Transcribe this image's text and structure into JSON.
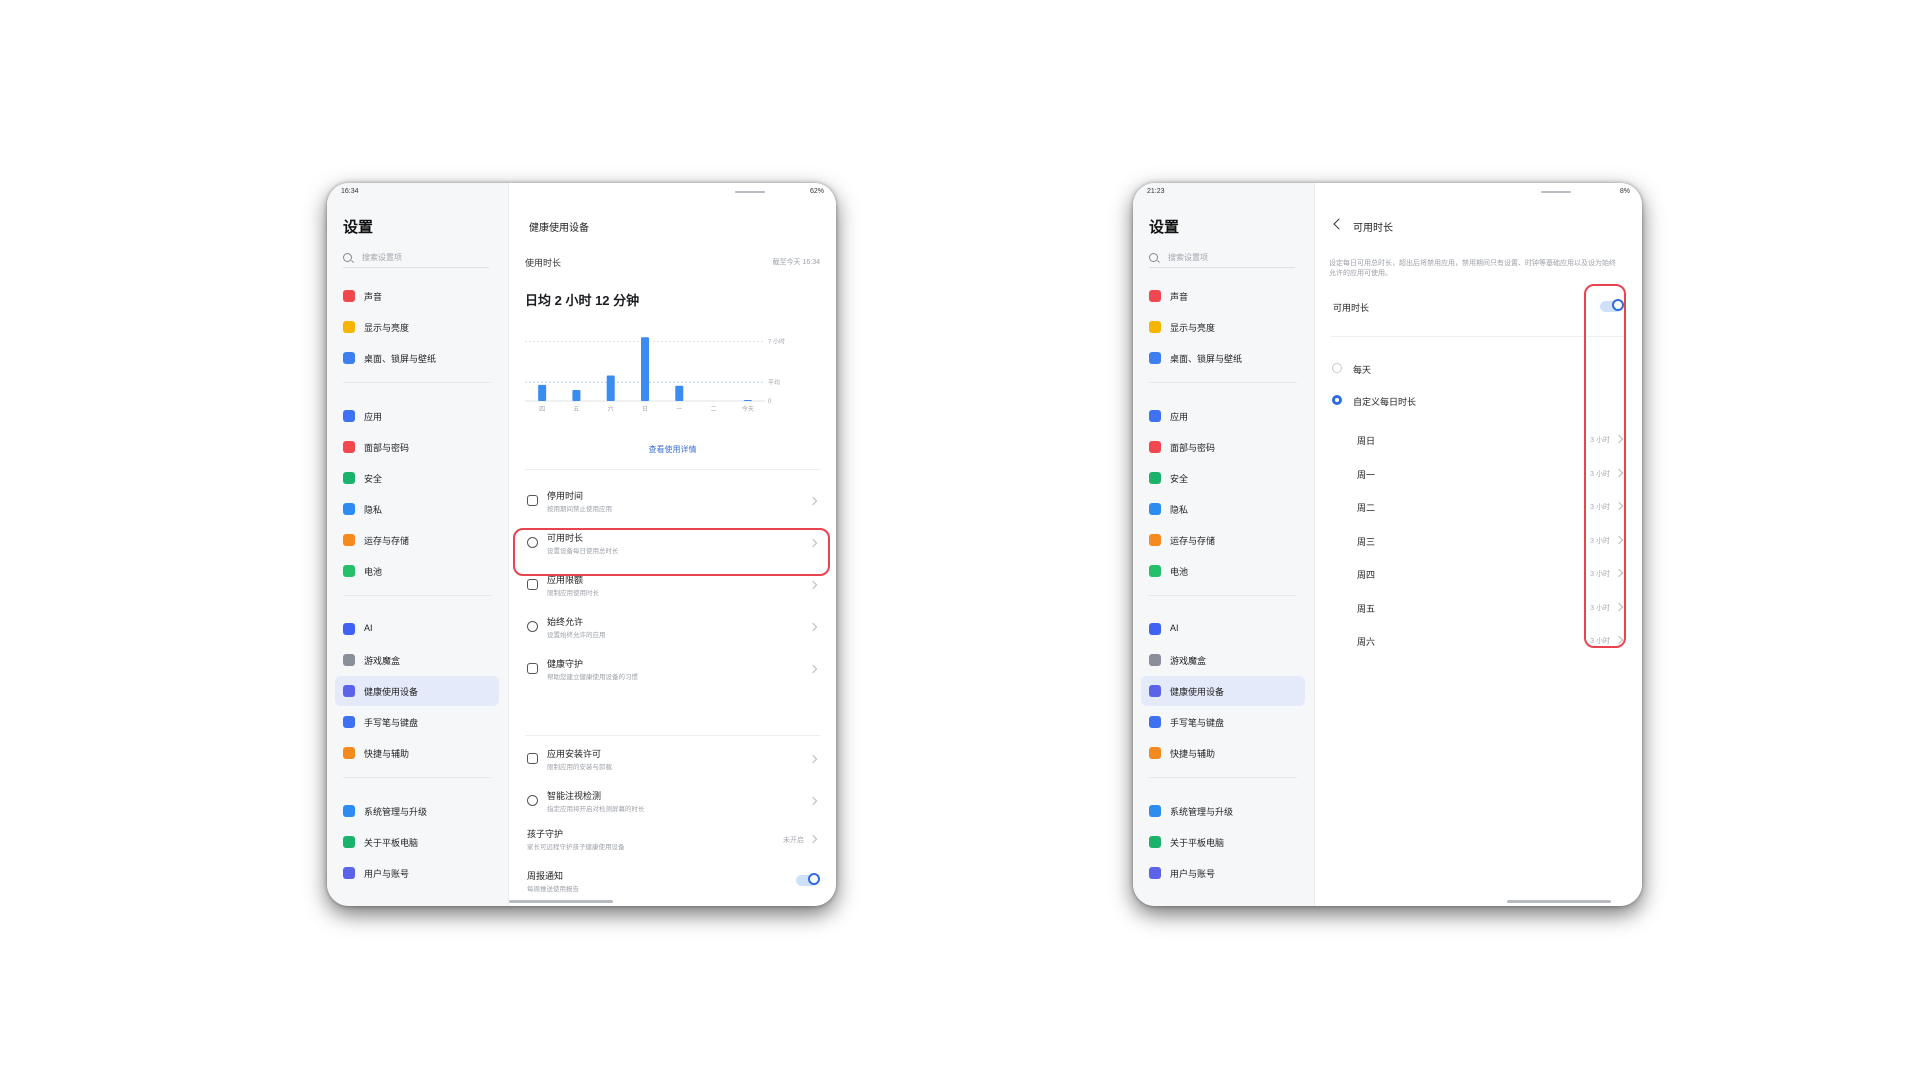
{
  "left": {
    "status_time": "16:34",
    "status_right": "62%",
    "sidebar": {
      "title": "设置",
      "search_placeholder": "搜索设置项",
      "groups": [
        [
          {
            "label": "声音",
            "icon": "speaker-icon",
            "color": "#f0484e"
          },
          {
            "label": "显示与亮度",
            "icon": "sun-icon",
            "color": "#f7b500"
          },
          {
            "label": "桌面、锁屏与壁纸",
            "icon": "wallpaper-icon",
            "color": "#3d7ef0"
          }
        ],
        [
          {
            "label": "应用",
            "icon": "apps-icon",
            "color": "#3f72f2"
          },
          {
            "label": "面部与密码",
            "icon": "face-icon",
            "color": "#f0484e"
          },
          {
            "label": "安全",
            "icon": "shield-icon",
            "color": "#1bb26c"
          },
          {
            "label": "隐私",
            "icon": "privacy-icon",
            "color": "#2d8cf0"
          },
          {
            "label": "运存与存储",
            "icon": "storage-icon",
            "color": "#f58a1f"
          },
          {
            "label": "电池",
            "icon": "battery-icon",
            "color": "#26c06a"
          }
        ],
        [
          {
            "label": "AI",
            "icon": "ai-icon",
            "color": "#3f62f2"
          },
          {
            "label": "游戏魔盒",
            "icon": "gamepad-icon",
            "color": "#8a8f99"
          },
          {
            "label": "健康使用设备",
            "icon": "hourglass-icon",
            "color": "#5b63e8",
            "active": true
          },
          {
            "label": "手写笔与键盘",
            "icon": "pen-icon",
            "color": "#3f72f2"
          },
          {
            "label": "快捷与辅助",
            "icon": "shortcut-icon",
            "color": "#f58a1f"
          }
        ],
        [
          {
            "label": "系统管理与升级",
            "icon": "system-icon",
            "color": "#2d8cf0"
          },
          {
            "label": "关于平板电脑",
            "icon": "info-icon",
            "color": "#1bb26c"
          },
          {
            "label": "用户与账号",
            "icon": "user-icon",
            "color": "#5b63e8"
          }
        ]
      ]
    },
    "main": {
      "title": "健康使用设备",
      "usage_label": "使用时长",
      "usage_time": "截至今天 16:34",
      "daily_avg": "日均 2 小时 12 分钟",
      "view_detail": "查看使用详情",
      "rows": [
        {
          "title": "停用时间",
          "sub": "按用期间禁止使用应用",
          "icon": "alarm-off-icon"
        },
        {
          "title": "可用时长",
          "sub": "设置设备每日使用总时长",
          "icon": "timer-icon",
          "highlight": true
        },
        {
          "title": "应用限额",
          "sub": "限制应用使用时长",
          "icon": "grid-icon"
        },
        {
          "title": "始终允许",
          "sub": "设置始终允许的应用",
          "icon": "allow-icon"
        },
        {
          "title": "健康守护",
          "sub": "帮助您建立健康使用设备的习惯",
          "icon": "leaf-icon"
        }
      ],
      "rows2": [
        {
          "title": "应用安装许可",
          "sub": "限制应用的安装与卸载",
          "icon": "install-icon"
        },
        {
          "title": "智能注视检测",
          "sub": "指定应用将开启对检测屏幕的时长",
          "icon": "eye-icon"
        }
      ],
      "child": {
        "title": "孩子守护",
        "sub": "家长可远程守护孩子健康使用设备",
        "value": "未开启"
      },
      "weekly": {
        "title": "周报通知",
        "sub": "每周推送使用报告"
      }
    }
  },
  "right": {
    "status_time": "21:23",
    "status_right": "8%",
    "main": {
      "title": "可用时长",
      "description": "设定每日可用总时长，超出后将禁用应用，禁用期间只有设置、时钟等基础应用以及设为始终允许的应用可使用。",
      "toggle_label": "可用时长",
      "options": [
        "每天",
        "自定义每日时长"
      ],
      "days": [
        "周日",
        "周一",
        "周二",
        "周三",
        "周四",
        "周五",
        "周六"
      ],
      "day_value": "3 小时"
    }
  },
  "chart_data": {
    "type": "bar",
    "categories": [
      "四",
      "五",
      "六",
      "日",
      "一",
      "二",
      "今天"
    ],
    "values": [
      1.9,
      1.3,
      3.0,
      7.5,
      1.8,
      0,
      0.1
    ],
    "ylim": [
      0,
      8
    ],
    "ytick_labels": [
      "7 小时",
      "平均",
      "0"
    ],
    "average": 2.2,
    "color": "#3b8cf2"
  }
}
